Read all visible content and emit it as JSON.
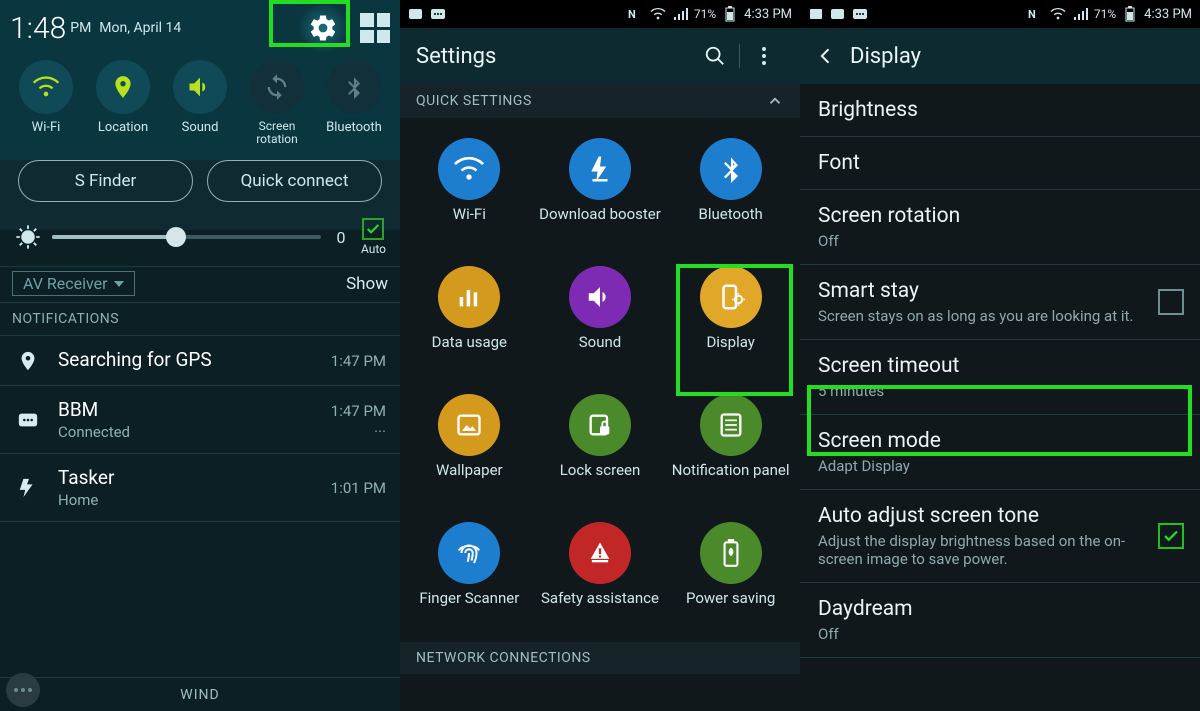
{
  "panel1": {
    "time": "1:48",
    "ampm": "PM",
    "date": "Mon, April 14",
    "toggles": [
      {
        "label": "Wi-Fi",
        "icon": "wifi",
        "on": true
      },
      {
        "label": "Location",
        "icon": "location",
        "on": true
      },
      {
        "label": "Sound",
        "icon": "sound",
        "on": true
      },
      {
        "label": "Screen rotation",
        "icon": "rotate",
        "on": false
      },
      {
        "label": "Bluetooth",
        "icon": "bluetooth",
        "on": false
      }
    ],
    "sfinder": "S Finder",
    "quickconnect": "Quick connect",
    "brightness_value": "0",
    "auto_label": "Auto",
    "av_receiver": "AV Receiver",
    "show": "Show",
    "notifications_header": "NOTIFICATIONS",
    "notifs": [
      {
        "title": "Searching for GPS",
        "sub": "",
        "time": "1:47 PM",
        "icon": "pin"
      },
      {
        "title": "BBM",
        "sub": "Connected",
        "time": "1:47 PM",
        "icon": "bbm"
      },
      {
        "title": "Tasker",
        "sub": "Home",
        "time": "1:01 PM",
        "icon": "bolt"
      }
    ],
    "bottom": "WIND"
  },
  "panel2": {
    "status": {
      "battery": "71%",
      "time": "4:33 PM"
    },
    "title": "Settings",
    "quick_settings": "QUICK SETTINGS",
    "tiles": [
      {
        "label": "Wi-Fi",
        "color": "#1d7ecf",
        "icon": "wifi"
      },
      {
        "label": "Download booster",
        "color": "#1d7ecf",
        "icon": "boost"
      },
      {
        "label": "Bluetooth",
        "color": "#1d7ecf",
        "icon": "bluetooth"
      },
      {
        "label": "Data usage",
        "color": "#d49a1e",
        "icon": "bars"
      },
      {
        "label": "Sound",
        "color": "#7d2bb3",
        "icon": "sound"
      },
      {
        "label": "Display",
        "color": "#e0a728",
        "icon": "display"
      },
      {
        "label": "Wallpaper",
        "color": "#d49a1e",
        "icon": "wallpaper"
      },
      {
        "label": "Lock screen",
        "color": "#4a8a2a",
        "icon": "lock"
      },
      {
        "label": "Notification panel",
        "color": "#4a8a2a",
        "icon": "panel"
      },
      {
        "label": "Finger Scanner",
        "color": "#1d7ecf",
        "icon": "finger"
      },
      {
        "label": "Safety assistance",
        "color": "#c22728",
        "icon": "safety"
      },
      {
        "label": "Power saving",
        "color": "#4a8a2a",
        "icon": "battery"
      }
    ],
    "network_connections": "NETWORK CONNECTIONS"
  },
  "panel3": {
    "status": {
      "battery": "71%",
      "time": "4:33 PM"
    },
    "title": "Display",
    "items": [
      {
        "title": "Brightness"
      },
      {
        "title": "Font"
      },
      {
        "title": "Screen rotation",
        "desc": "Off"
      },
      {
        "title": "Smart stay",
        "desc": "Screen stays on as long as you are looking at it.",
        "checkbox": true,
        "checked": false
      },
      {
        "title": "Screen timeout",
        "desc": "5 minutes"
      },
      {
        "title": "Screen mode",
        "desc": "Adapt Display"
      },
      {
        "title": "Auto adjust screen tone",
        "desc": "Adjust the display brightness based on the on-screen image to save power.",
        "checkbox": true,
        "checked": true
      },
      {
        "title": "Daydream",
        "desc": "Off"
      }
    ]
  }
}
